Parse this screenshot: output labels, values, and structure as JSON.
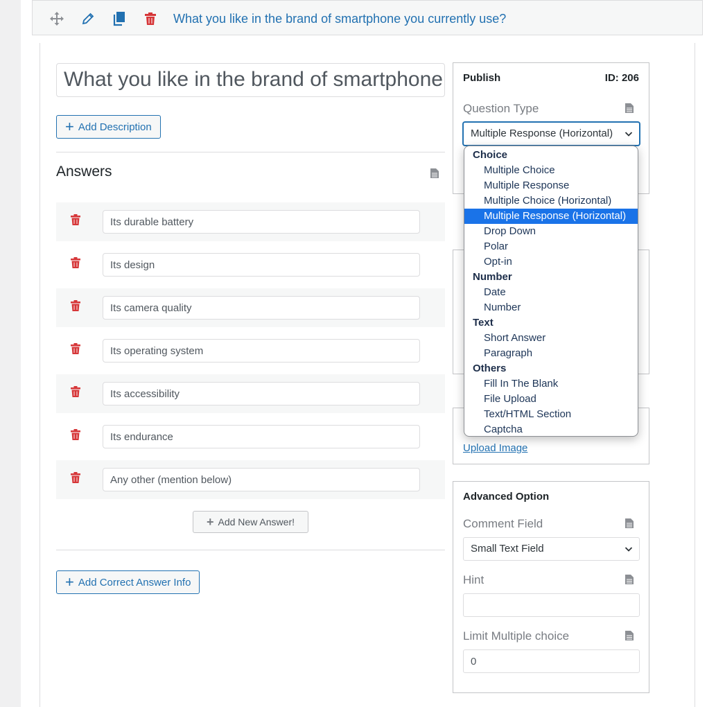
{
  "toolbar": {
    "icons": [
      "move-icon",
      "pencil-icon",
      "copy-icon",
      "trash-icon"
    ],
    "title": "What you like in the brand of smartphone you currently use?"
  },
  "question": {
    "title_value": "What you like in the brand of smartphone you currently use?",
    "add_description_label": "Add Description"
  },
  "answers": {
    "heading": "Answers",
    "items": [
      "Its durable battery",
      "Its design",
      "Its camera quality",
      "Its operating system",
      "Its accessibility",
      "Its endurance",
      "Any other (mention below)"
    ],
    "add_new_label": "Add New Answer!",
    "add_correct_info_label": "Add Correct Answer Info"
  },
  "publish": {
    "title": "Publish",
    "id_label": "ID: 206",
    "question_type_label": "Question Type",
    "question_type_value": "Multiple Response (Horizontal)"
  },
  "question_type_dropdown": {
    "groups": [
      {
        "label": "Choice",
        "options": [
          "Multiple Choice",
          "Multiple Response",
          "Multiple Choice (Horizontal)",
          "Multiple Response (Horizontal)",
          "Drop Down",
          "Polar",
          "Opt-in"
        ]
      },
      {
        "label": "Number",
        "options": [
          "Date",
          "Number"
        ]
      },
      {
        "label": "Text",
        "options": [
          "Short Answer",
          "Paragraph"
        ]
      },
      {
        "label": "Others",
        "options": [
          "Fill In The Blank",
          "File Upload",
          "Text/HTML Section",
          "Captcha"
        ]
      }
    ],
    "selected": "Multiple Response (Horizontal)"
  },
  "featured_image": {
    "upload_label": "Upload Image"
  },
  "advanced": {
    "title": "Advanced Option",
    "comment_field_label": "Comment Field",
    "comment_field_value": "Small Text Field",
    "hint_label": "Hint",
    "hint_value": "",
    "limit_label": "Limit Multiple choice",
    "limit_value": "0"
  },
  "colors": {
    "accent": "#2271b1",
    "danger": "#d63638",
    "selected": "#1a73e8"
  }
}
